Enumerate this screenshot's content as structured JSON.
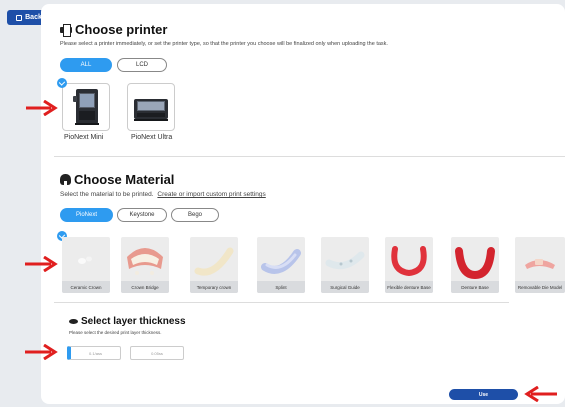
{
  "toolbar": {
    "back_label": "Back"
  },
  "printer_section": {
    "title": "Choose printer",
    "description": "Please select a printer immediately, or set the printer type, so that the printer you choose will be finalized only when uploading the task.",
    "filters": [
      {
        "label": "ALL",
        "active": true
      },
      {
        "label": "LCD",
        "active": false
      }
    ],
    "printers": [
      {
        "name": "PioNext Mini",
        "selected": true
      },
      {
        "name": "PioNext Ultra",
        "selected": false
      }
    ]
  },
  "material_section": {
    "title": "Choose Material",
    "description": "Select the material to be printed.",
    "link": "Create or import custom print settings",
    "brands": [
      {
        "label": "PioNext",
        "active": true
      },
      {
        "label": "Keystone",
        "active": false
      },
      {
        "label": "Bego",
        "active": false
      }
    ],
    "materials": [
      {
        "name": "Ceramic Crown",
        "selected": true
      },
      {
        "name": "Crown Bridge",
        "selected": false
      },
      {
        "name": "Temporary crown",
        "selected": false
      },
      {
        "name": "Splint",
        "selected": false
      },
      {
        "name": "Surgical Guide",
        "selected": false
      },
      {
        "name": "Flexible denture Base",
        "selected": false
      },
      {
        "name": "Denture Base",
        "selected": false
      },
      {
        "name": "Removable Die Model",
        "selected": false
      }
    ]
  },
  "layer_section": {
    "title": "Select layer thickness",
    "description": "Please select the desired print layer thickness.",
    "options": [
      {
        "label": "0.1/ass"
      },
      {
        "label": "0.05ss"
      }
    ]
  },
  "footer": {
    "use_label": "Use"
  },
  "colors": {
    "accent": "#2e9bf0",
    "primary": "#1e4fa8",
    "arrow": "#e01f1f"
  }
}
